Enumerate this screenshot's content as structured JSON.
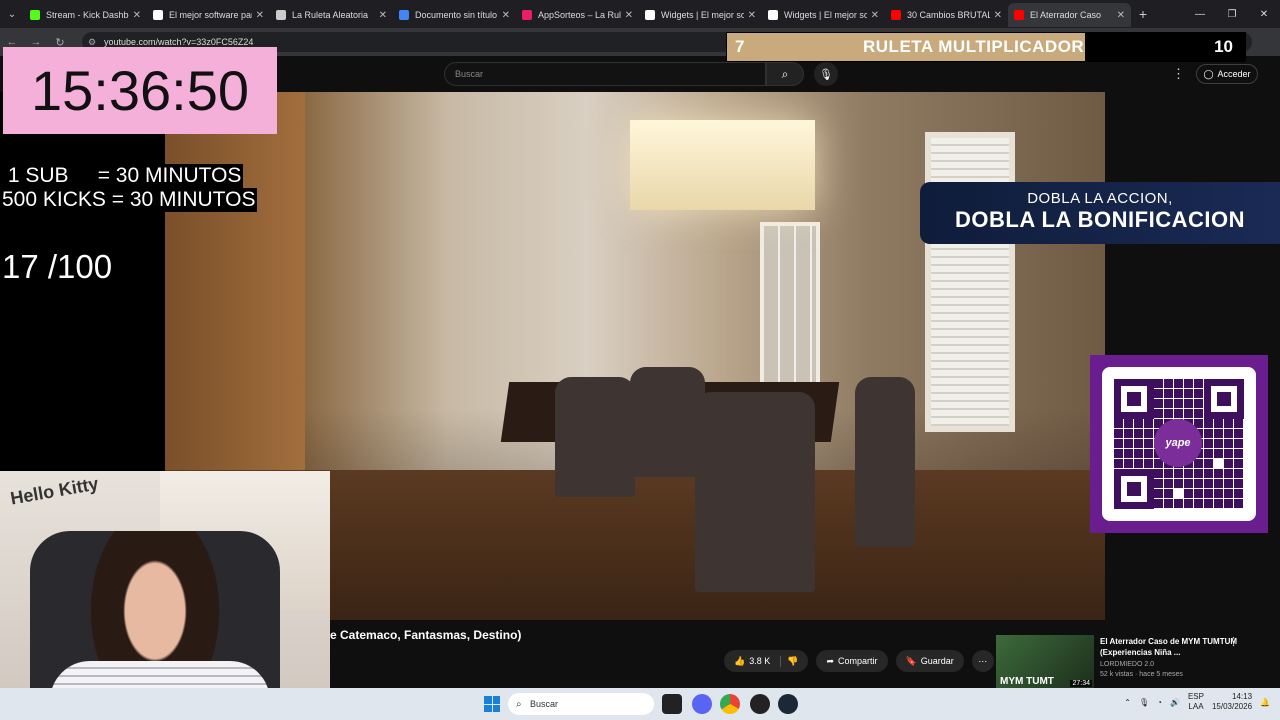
{
  "browser": {
    "tabs": [
      {
        "title": "Stream - Kick Dashbo",
        "color": "#53fc18"
      },
      {
        "title": "El mejor software par",
        "color": "#ffffff"
      },
      {
        "title": "La Ruleta Aleatoria",
        "color": "#cccccc"
      },
      {
        "title": "Documento sin título",
        "color": "#4285f4"
      },
      {
        "title": "AppSorteos – La Rule",
        "color": "#e91e63"
      },
      {
        "title": "Widgets | El mejor so",
        "color": "#ffffff"
      },
      {
        "title": "Widgets | El mejor so",
        "color": "#ffffff"
      },
      {
        "title": "30 Cambios BRUTALE",
        "color": "#ff0000"
      },
      {
        "title": "El Aterrador Caso",
        "color": "#ff0000"
      }
    ],
    "url": "youtube.com/watch?v=33z0FC56Z24"
  },
  "youtube": {
    "search_placeholder": "Buscar",
    "signin_label": "Acceder",
    "video_title": "e Catemaco, Fantasmas, Destino)",
    "likes": "3.8 K",
    "share_label": "Compartir",
    "save_label": "Guardar",
    "recommended": {
      "title": "El Aterrador Caso de MYM TUMTUM (Experiencias Niña ...",
      "channel": "LORDMIEDO 2.0",
      "meta": "52 k vistas · hace 5 meses",
      "thumb_text": "MYM TUMT",
      "duration": "27:34"
    }
  },
  "overlays": {
    "timer": "15:36:50",
    "rule1": " 1 SUB     = 30 MINUTOS",
    "rule2": "500 KICKS = 30 MINUTOS",
    "count": "17 /100",
    "roulette_left": "7",
    "roulette_title": "RULETA MULTIPLICADORA",
    "roulette_right": "10",
    "promo_line1": "DOBLA LA ACCION,",
    "promo_line2": "DOBLA LA BONIFICACION",
    "qr_logo": "yape",
    "webcam_text": "Hello Kitty"
  },
  "taskbar": {
    "search_placeholder": "Buscar",
    "lang_top": "ESP",
    "lang_bottom": "LAA",
    "time": "14:13",
    "date": "15/03/2026"
  }
}
